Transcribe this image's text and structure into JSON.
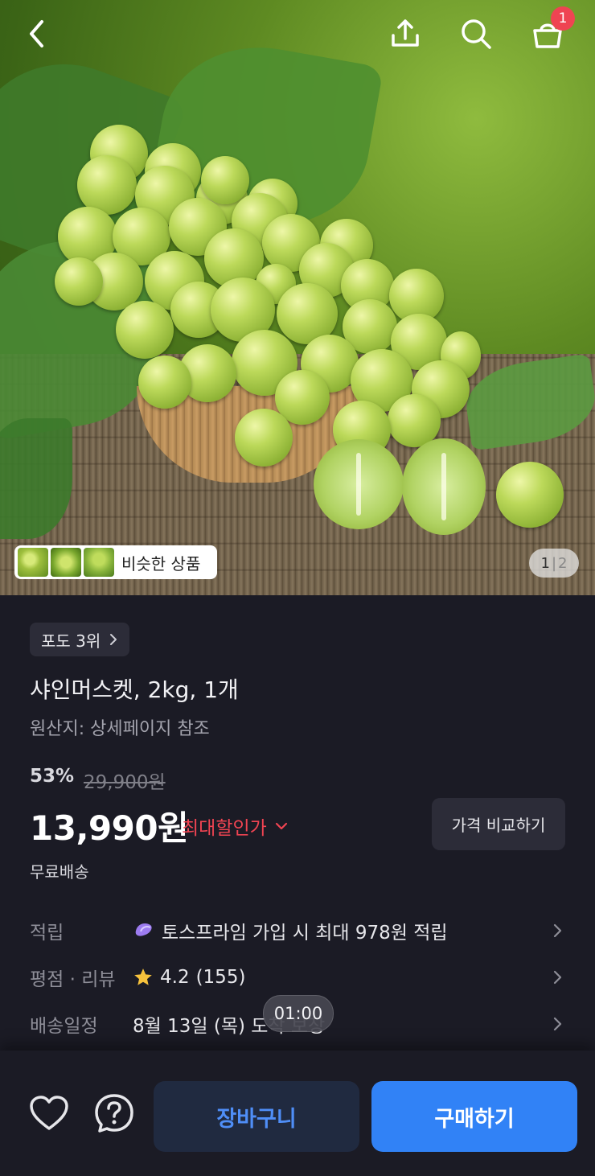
{
  "header": {
    "back_icon": "chevron-left-icon",
    "share_icon": "share-icon",
    "search_icon": "search-icon",
    "cart_icon": "shopping-bag-icon",
    "cart_count": "1"
  },
  "hero": {
    "similar_label": "비슷한 상품",
    "page_current": "1",
    "page_separator": "|",
    "page_total": "2"
  },
  "product": {
    "rank_chip": "포도 3위",
    "title": "샤인머스켓, 2kg, 1개",
    "origin": "원산지: 상세페이지 참조",
    "discount_rate": "53%",
    "original_price": "29,900원",
    "price": "13,990원",
    "max_discount_label": "최대할인가",
    "compare_button": "가격 비교하기",
    "shipping": "무료배송"
  },
  "info_rows": [
    {
      "key": "적립",
      "value": "토스프라임 가입 시 최대 978원 적립"
    },
    {
      "key": "평점 · 리뷰",
      "rating": "4.2",
      "count": "(155)"
    },
    {
      "key": "배송일정",
      "value": "8월 13일 (목) 도착 보장"
    }
  ],
  "timer": "01:00",
  "bottom_bar": {
    "wishlist_icon": "heart-icon",
    "help_icon": "question-icon",
    "cart_button": "장바구니",
    "buy_button": "구매하기"
  },
  "colors": {
    "background": "#1b1b25",
    "accent_blue": "#3182f6",
    "discount_red": "#f04452",
    "badge_red": "#ef4452",
    "star": "#f7c23c"
  }
}
